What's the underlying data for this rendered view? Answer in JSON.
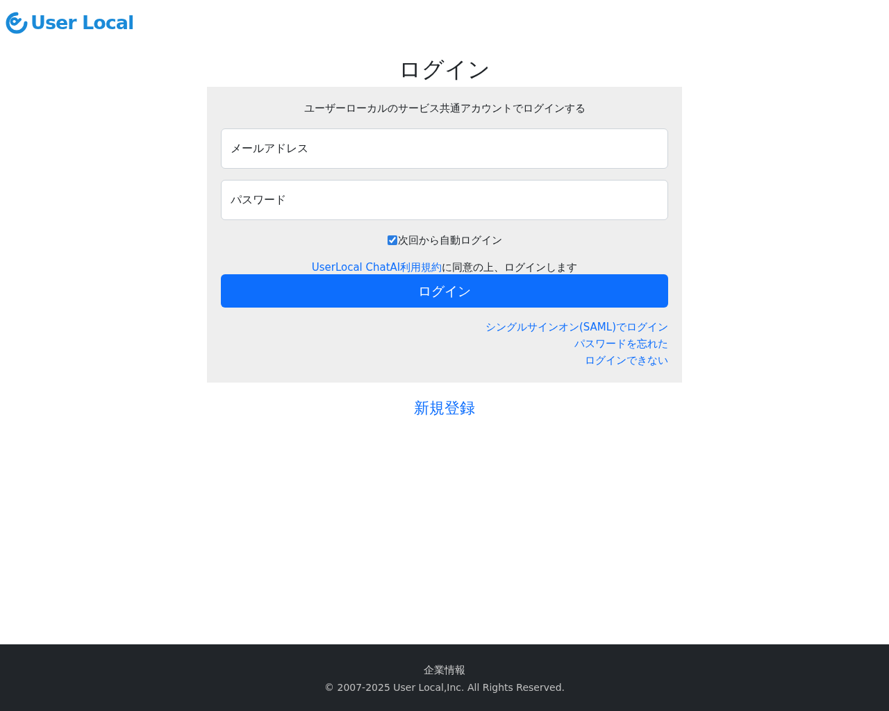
{
  "header": {
    "logo_text": "User Local"
  },
  "title": "ログイン",
  "login_panel": {
    "subtitle": "ユーザーローカルのサービス共通アカウントでログインする",
    "email_field": {
      "placeholder": "メールアドレス"
    },
    "password_field": {
      "placeholder": "パスワード"
    },
    "auto_login": {
      "label": "次回から自動ログイン",
      "checked": true
    },
    "terms": {
      "link": "UserLocal ChatAI利用規約",
      "text": "に同意の上、ログインします"
    },
    "submit_button": "ログイン",
    "links": [
      "シングルサインオン(SAML)でログイン",
      "パスワードを忘れた",
      "ログインできない"
    ]
  },
  "register_link": "新規登録",
  "footer": {
    "company_link": "企業情報",
    "copyright": "© 2007-2025 User Local,Inc. All Rights Reserved."
  }
}
